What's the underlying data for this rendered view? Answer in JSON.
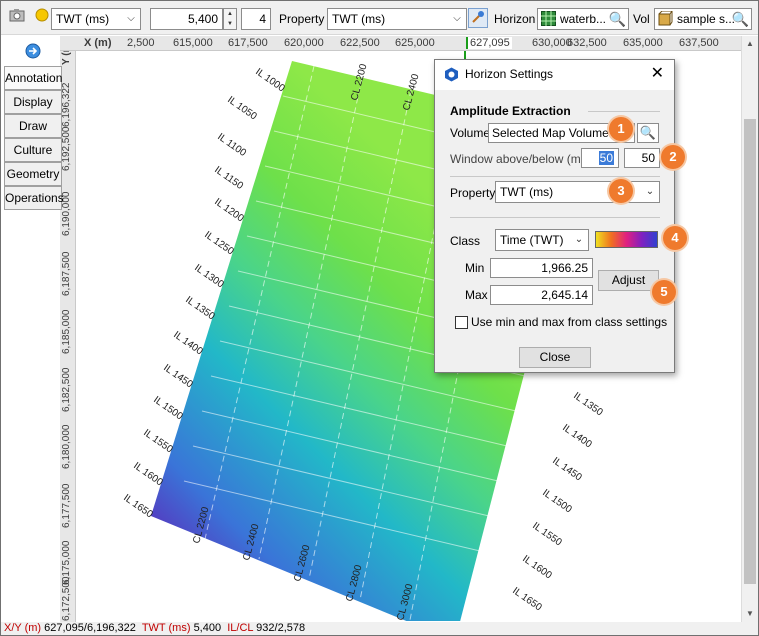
{
  "toolbar": {
    "attribute_combo": "TWT (ms)",
    "value_field": "5,400",
    "step_field": "4",
    "property_label": "Property",
    "property_combo": "TWT (ms)",
    "horizon_label": "Horizon",
    "horizon_value": "waterb...",
    "vol_label": "Vol",
    "vol_value": "sample s..."
  },
  "ruler": {
    "x_axis_label": "X (m)",
    "x_ticks": [
      "2,500",
      "615,000",
      "617,500",
      "620,000",
      "622,500",
      "625,000",
      "627,095",
      "630,000",
      "632,500",
      "635,000",
      "637,500"
    ],
    "y_axis_label": "Y (m)",
    "y_ticks": [
      "6,196,322",
      "6,192,500",
      "6,190,000",
      "6,187,500",
      "6,185,000",
      "6,182,500",
      "6,180,000",
      "6,177,500",
      "6,175,000",
      "6,172,500"
    ]
  },
  "side_tabs": [
    "Annotation",
    "Display",
    "Draw",
    "Culture",
    "Geometry",
    "Operations"
  ],
  "map": {
    "il_left_labels": [
      "IL 1000",
      "IL 1050",
      "IL 1100",
      "IL 1150",
      "IL 1200",
      "IL 1250",
      "IL 1300",
      "IL 1350",
      "IL 1400",
      "IL 1450",
      "IL 1500",
      "IL 1550",
      "IL 1600",
      "IL 1650"
    ],
    "il_right_labels": [
      "IL 1350",
      "IL 1400",
      "IL 1450",
      "IL 1500",
      "IL 1550",
      "IL 1600",
      "IL 1650"
    ],
    "cl_top_labels": [
      "CL 2200",
      "CL 2400"
    ],
    "cl_bottom_labels": [
      "CL 2200",
      "CL 2400",
      "CL 2600",
      "CL 2800",
      "CL 3000"
    ],
    "gradient": [
      "#6a0dad",
      "#3a74d8",
      "#22b8c8",
      "#4ad48a",
      "#6ee04a",
      "#8ee848"
    ]
  },
  "dialog": {
    "title": "Horizon Settings",
    "section": "Amplitude Extraction",
    "volume_label": "Volume",
    "volume_value": "Selected Map Volume",
    "window_label": "Window above/below (ms)",
    "window_above": "50",
    "window_below": "50",
    "property_label": "Property",
    "property_value": "TWT (ms)",
    "class_label": "Class",
    "class_value": "Time (TWT)",
    "min_label": "Min",
    "min_value": "1,966.25",
    "max_label": "Max",
    "max_value": "2,645.14",
    "adjust_label": "Adjust",
    "checkbox_label": "Use min and max from class settings",
    "checkbox_checked": false,
    "close_label": "Close",
    "badges": [
      "1",
      "2",
      "3",
      "4",
      "5"
    ],
    "accent": "#ef7a2d"
  },
  "status": {
    "xy_key": "X/Y (m)",
    "xy_value": "627,095/6,196,322",
    "twt_key": "TWT (ms)",
    "twt_value": "5,400",
    "ilcl_key": "IL/CL",
    "ilcl_value": "932/2,578"
  }
}
